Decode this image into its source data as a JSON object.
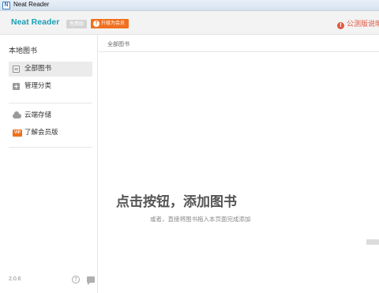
{
  "window": {
    "title": "Neat Reader",
    "logo_letter": "N"
  },
  "header": {
    "app_name": "Neat Reader",
    "free_badge": "免费版",
    "upgrade_label": "升级为会员",
    "upgrade_icon_glyph": "↑",
    "notice_text": "公测版说明",
    "notice_icon_glyph": "!",
    "accent_color": "#1aa0b5",
    "upgrade_color": "#f0701e",
    "notice_color": "#e25640"
  },
  "sidebar": {
    "heading": "本地图书",
    "items": [
      {
        "label": "全部图书",
        "icon": "book-icon",
        "active": true
      },
      {
        "label": "管理分类",
        "icon": "plus-icon",
        "active": false
      },
      {
        "label": "云端存储",
        "icon": "cloud-icon",
        "active": false
      },
      {
        "label": "了解会员版",
        "icon": "vip-icon",
        "active": false
      }
    ],
    "vip_glyph": "VIP",
    "version": "2.0.6",
    "help_glyph": "?"
  },
  "main": {
    "breadcrumb": "全部图书",
    "empty_title": "点击按钮，添加图书",
    "empty_subtitle": "或者，直接将图书拖入本页面完成添加"
  }
}
